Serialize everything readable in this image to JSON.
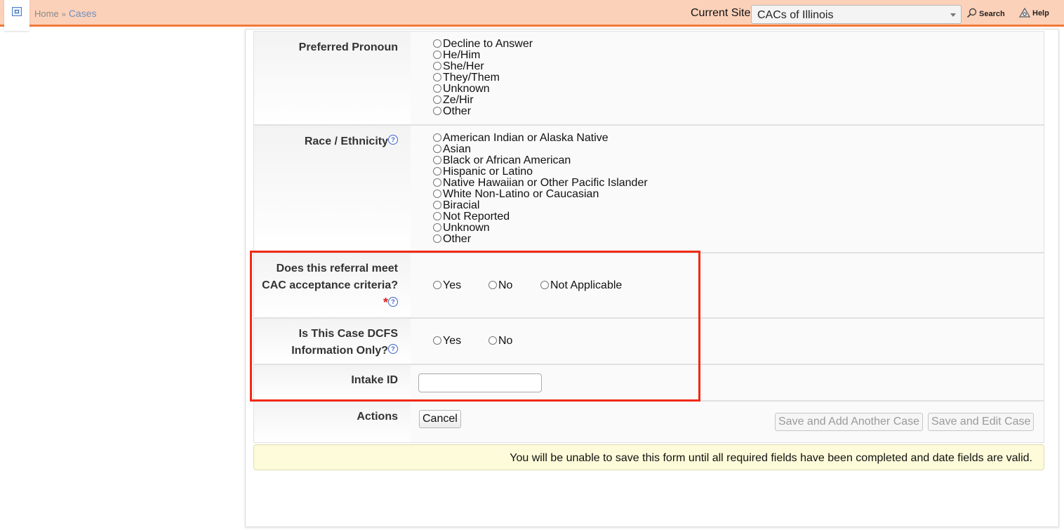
{
  "header": {
    "breadcrumb": [
      "Home",
      "Cases"
    ],
    "current_site_label": "Current Site",
    "current_site_value": "CACs of Illinois",
    "search_label": "Search",
    "help_label": "Help",
    "accent_color": "#f07a3a",
    "background_color": "#fcd1b9"
  },
  "form": {
    "pronoun": {
      "label": "Preferred Pronoun",
      "options": [
        "Decline to Answer",
        "He/Him",
        "She/Her",
        "They/Them",
        "Unknown",
        "Ze/Hir",
        "Other"
      ]
    },
    "race": {
      "label": "Race / Ethnicity",
      "options": [
        "American Indian or Alaska Native",
        "Asian",
        "Black or African American",
        "Hispanic or Latino",
        "Native Hawaiian or Other Pacific Islander",
        "White Non-Latino or Caucasian",
        "Biracial",
        "Not Reported",
        "Unknown",
        "Other"
      ]
    },
    "acceptance": {
      "label_line1": "Does this referral meet",
      "label_line2": "CAC acceptance criteria?",
      "required_mark": "*",
      "options": [
        "Yes",
        "No",
        "Not Applicable"
      ]
    },
    "dcfs": {
      "label_line1": "Is This Case DCFS",
      "label_line2": "Information Only?",
      "options": [
        "Yes",
        "No"
      ]
    },
    "intake": {
      "label": "Intake ID",
      "value": ""
    },
    "actions": {
      "label": "Actions",
      "cancel": "Cancel",
      "save_add_another": "Save and Add Another Case",
      "save_edit": "Save and Edit Case"
    },
    "notice": "You will be unable to save this form until all required fields have been completed and date fields are valid.",
    "help_glyph": "?"
  },
  "highlight_color": "#f02a13"
}
